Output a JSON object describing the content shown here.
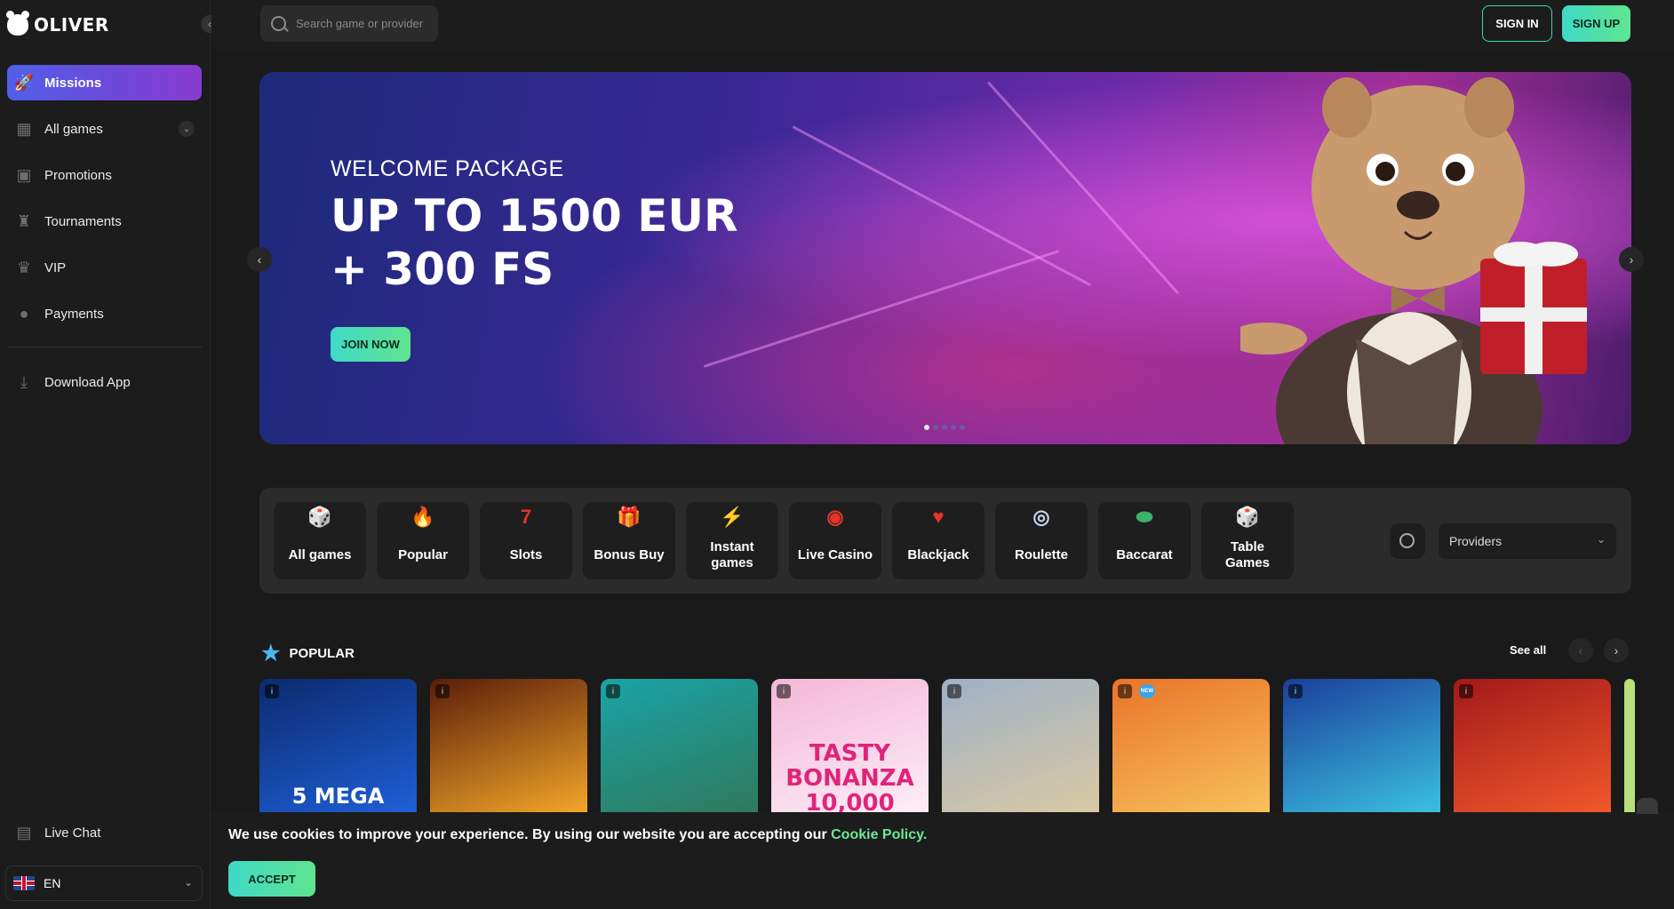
{
  "brand": {
    "name": "OLIVER"
  },
  "sidebar": {
    "items": [
      {
        "label": "Missions",
        "icon": "rocket-icon",
        "active": true
      },
      {
        "label": "All games",
        "icon": "games-icon",
        "expandable": true
      },
      {
        "label": "Promotions",
        "icon": "gift-icon"
      },
      {
        "label": "Tournaments",
        "icon": "trophy-icon"
      },
      {
        "label": "VIP",
        "icon": "crown-icon"
      },
      {
        "label": "Payments",
        "icon": "coin-icon"
      },
      {
        "label": "Download App",
        "icon": "download-icon"
      }
    ],
    "live_chat": "Live Chat",
    "language": "EN"
  },
  "header": {
    "search_placeholder": "Search game or provider",
    "sign_in": "SIGN IN",
    "sign_up": "SIGN UP"
  },
  "banner": {
    "eyebrow": "WELCOME PACKAGE",
    "line1": "UP TO 1500 EUR",
    "line2": "+ 300 FS",
    "cta": "JOIN NOW",
    "slide_count": 5,
    "active_slide": 1
  },
  "categories": {
    "items": [
      {
        "label": "All games",
        "icon": "dice-icon"
      },
      {
        "label": "Popular",
        "icon": "flame-icon"
      },
      {
        "label": "Slots",
        "icon": "seven-icon"
      },
      {
        "label": "Bonus Buy",
        "icon": "giftbox-icon"
      },
      {
        "label": "Instant games",
        "icon": "lightning-icon"
      },
      {
        "label": "Live Casino",
        "icon": "chip-icon"
      },
      {
        "label": "Blackjack",
        "icon": "cards-icon"
      },
      {
        "label": "Roulette",
        "icon": "roulette-icon"
      },
      {
        "label": "Baccarat",
        "icon": "baccarat-icon"
      },
      {
        "label": "Table Games",
        "icon": "table-dice-icon"
      }
    ],
    "providers_label": "Providers"
  },
  "popular": {
    "title": "POPULAR",
    "see_all": "See all",
    "games": [
      {
        "art_text": "5 MEGA",
        "colors": [
          "#0b2a6e",
          "#1f5fd6"
        ]
      },
      {
        "art_text": "",
        "colors": [
          "#5a1d0a",
          "#f3a628"
        ]
      },
      {
        "art_text": "",
        "colors": [
          "#1aa3a6",
          "#2f7a5c"
        ]
      },
      {
        "art_text": "TASTY BONANZA 10,000",
        "colors": [
          "#f4b6d8",
          "#fdeef6"
        ],
        "new": false
      },
      {
        "art_text": "",
        "colors": [
          "#9fb1c6",
          "#d9c9a4"
        ]
      },
      {
        "art_text": "",
        "colors": [
          "#e9742a",
          "#f7c15a"
        ],
        "new": true
      },
      {
        "art_text": "",
        "colors": [
          "#1b3f9a",
          "#3ac0e0"
        ]
      },
      {
        "art_text": "",
        "colors": [
          "#a3191a",
          "#f0582a"
        ]
      }
    ],
    "new_badge": "NEW"
  },
  "cookie": {
    "text": "We use cookies to improve your experience. By using our website you are accepting our ",
    "link": "Cookie Policy.",
    "accept": "ACCEPT"
  }
}
